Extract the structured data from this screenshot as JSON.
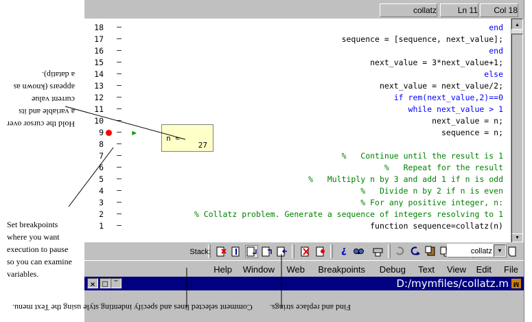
{
  "window": {
    "title": "D:/mymfiles/collatz.m",
    "title_icon": "matlab-file-icon",
    "title_bar_color": "#000080"
  },
  "menu": [
    "File",
    "Edit",
    "View",
    "Text",
    "Debug",
    "Breakpoints",
    "Web",
    "Window",
    "Help"
  ],
  "toolbar": {
    "stack_label": "Stack:",
    "stack_value": "collatz",
    "buttons": [
      "new-file-icon",
      "open-file-icon",
      "save-icon",
      "cut-icon",
      "copy-icon",
      "paste-icon",
      "undo-icon",
      "redo-icon",
      "print-icon",
      "find-icon",
      "help-icon",
      "set-clear-breakpoint-icon",
      "clear-all-breakpoints-icon",
      "step-icon",
      "step-in-icon",
      "step-out-icon",
      "continue-icon",
      "exit-debug-icon"
    ]
  },
  "code": {
    "lines": [
      {
        "num": "1",
        "text": "function sequence=collatz(n)",
        "kind": "code"
      },
      {
        "num": "2",
        "text": "% Collatz problem. Generate a sequence of integers resolving to 1",
        "kind": "comment"
      },
      {
        "num": "3",
        "text": "% For any positive integer, n:",
        "kind": "comment"
      },
      {
        "num": "4",
        "text": "%   Divide n by 2 if n is even",
        "kind": "comment"
      },
      {
        "num": "5",
        "text": "%   Multiply n by 3 and add 1 if n is odd",
        "kind": "comment"
      },
      {
        "num": "6",
        "text": "%   Repeat for the result",
        "kind": "comment"
      },
      {
        "num": "7",
        "text": "%   Continue until the result is 1",
        "kind": "comment"
      },
      {
        "num": "8",
        "text": "",
        "kind": "code"
      },
      {
        "num": "9",
        "text": "sequence = n;",
        "kind": "code"
      },
      {
        "num": "10",
        "text": "next_value = n;",
        "kind": "code"
      },
      {
        "num": "11",
        "text": "while next_value > 1",
        "kind": "keyword"
      },
      {
        "num": "12",
        "text": "    if rem(next_value,2)==0",
        "kind": "keyword"
      },
      {
        "num": "13",
        "text": "        next_value = next_value/2;",
        "kind": "code"
      },
      {
        "num": "14",
        "text": "    else",
        "kind": "keyword"
      },
      {
        "num": "15",
        "text": "        next_value = 3*next_value+1;",
        "kind": "code"
      },
      {
        "num": "16",
        "text": "    end",
        "kind": "keyword"
      },
      {
        "num": "17",
        "text": "    sequence = [sequence, next_value];",
        "kind": "code"
      },
      {
        "num": "18",
        "text": "end",
        "kind": "keyword"
      }
    ],
    "breakpoint_line": "9",
    "current_line": "9",
    "colors": {
      "comment": "#008000",
      "keyword": "#0000ff",
      "code": "#000000",
      "breakpoint": "#ff0000",
      "arrow": "#00a000"
    }
  },
  "datatip": {
    "name": "n =",
    "value": "27"
  },
  "status": {
    "function": "collatz",
    "line": "Ln 11",
    "col": "Col 18"
  },
  "annotations": {
    "breakpoints": [
      "Set breakpoints",
      "where you want",
      "execution to pause",
      "so you can examine",
      "variables."
    ],
    "datatip": [
      "Hold the cursor over",
      "a variable and its",
      "current value",
      "appears (known as",
      "a datatip)."
    ],
    "text_menu": "Comment selected lines and specify indenting style using the Text menu.",
    "find": "Find and replace strings."
  }
}
